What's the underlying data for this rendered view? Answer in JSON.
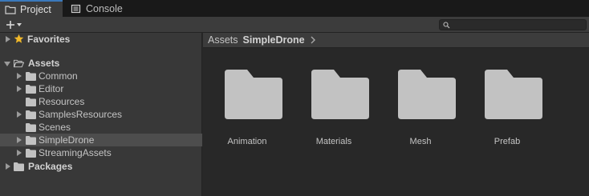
{
  "tabs": [
    {
      "label": "Project",
      "icon": "folder-icon",
      "active": true
    },
    {
      "label": "Console",
      "icon": "console-icon",
      "active": false
    }
  ],
  "toolbar": {
    "add_icon": "plus-icon",
    "dropdown_icon": "caret-down-icon",
    "search_placeholder": ""
  },
  "tree": {
    "favorites": {
      "label": "Favorites",
      "icon": "star-icon"
    },
    "assets": {
      "label": "Assets"
    },
    "children": [
      {
        "label": "Common",
        "expandable": true
      },
      {
        "label": "Editor",
        "expandable": true
      },
      {
        "label": "Resources",
        "expandable": false
      },
      {
        "label": "SamplesResources",
        "expandable": true
      },
      {
        "label": "Scenes",
        "expandable": false
      },
      {
        "label": "SimpleDrone",
        "expandable": true,
        "selected": true
      },
      {
        "label": "StreamingAssets",
        "expandable": true
      }
    ],
    "packages": {
      "label": "Packages"
    }
  },
  "breadcrumb": {
    "root": "Assets",
    "current": "SimpleDrone"
  },
  "assets_grid": [
    {
      "name": "Animation"
    },
    {
      "name": "Materials"
    },
    {
      "name": "Mesh"
    },
    {
      "name": "Prefab"
    }
  ],
  "colors": {
    "accent": "#3a79bb",
    "folder": "#c2c2c2",
    "star": "#f0b82a"
  }
}
